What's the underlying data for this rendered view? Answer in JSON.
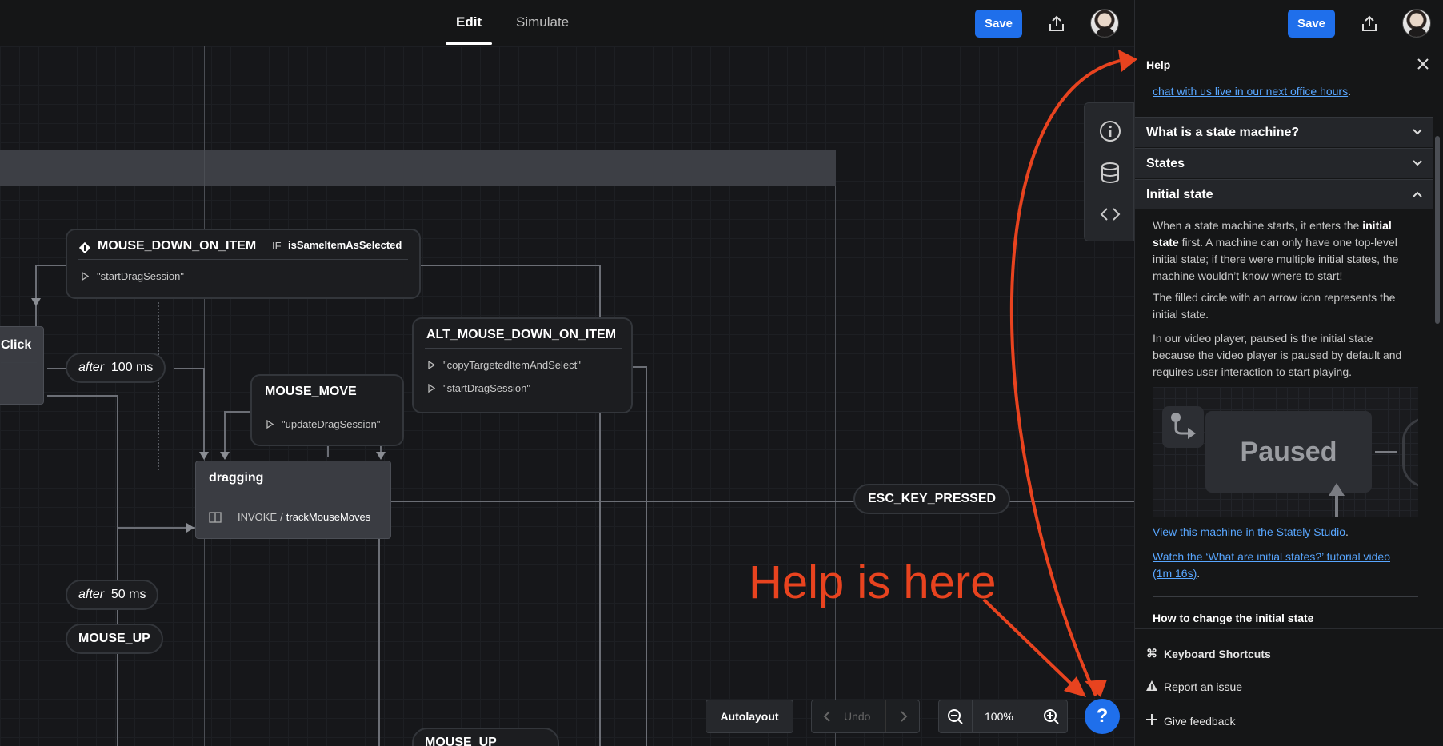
{
  "topbar": {
    "tabs": [
      {
        "label": "Edit",
        "active": true
      },
      {
        "label": "Simulate",
        "active": false
      }
    ],
    "save_label": "Save"
  },
  "panel": {
    "save_label": "Save",
    "help_title": "Help",
    "intro_link": "chat with us live in our next office hours",
    "intro_tail": ".",
    "accordions": [
      {
        "label": "What is a state machine?",
        "expanded": false
      },
      {
        "label": "States",
        "expanded": false
      },
      {
        "label": "Initial state",
        "expanded": true
      }
    ],
    "initial_state": {
      "p1_a": "When a state machine starts, it enters the ",
      "p1_b": "initial state",
      "p1_c": " first. A machine can only have one top-level initial state; if there were multiple initial states, the machine wouldn’t know where to start!",
      "p2": "The filled circle with an arrow icon represents the initial state.",
      "p3": "In our video player, paused is the initial state because the video player is paused by default and requires user interaction to start playing.",
      "illustration_label": "Paused",
      "link1": "View this machine in the Stately Studio",
      "link2": "Watch the ‘What are initial states?’ tutorial video (1m 16s)",
      "subheading": "How to change the initial state"
    },
    "footer": [
      {
        "label": "Keyboard Shortcuts",
        "icon": "command-icon"
      },
      {
        "label": "Report an issue",
        "icon": "warning-icon"
      },
      {
        "label": "Give feedback",
        "icon": "plus-icon"
      }
    ]
  },
  "canvas": {
    "nodes": {
      "mouse_down_on_item": {
        "event": "MOUSE_DOWN_ON_ITEM",
        "if_label": "IF",
        "guard": "isSameItemAsSelected",
        "actions": [
          "\"startDragSession\""
        ]
      },
      "alt_mouse_down": {
        "event": "ALT_MOUSE_DOWN_ON_ITEM",
        "actions": [
          "\"copyTargetedItemAndSelect\"",
          "\"startDragSession\""
        ]
      },
      "mouse_move": {
        "event": "MOUSE_MOVE",
        "actions": [
          "\"updateDragSession\""
        ]
      },
      "dragging": {
        "name": "dragging",
        "invoke_label": "INVOKE",
        "invoke_sep": "/",
        "invoke_src": "trackMouseMoves"
      },
      "click_state": {
        "name": "Click"
      }
    },
    "pills": {
      "after100_after": "after",
      "after100_time": "100 ms",
      "after50_after": "after",
      "after50_time": "50 ms",
      "mouse_up": "MOUSE_UP",
      "mouse_up_2": "MOUSE_UP",
      "esc": "ESC_KEY_PRESSED"
    }
  },
  "bottom_controls": {
    "autolayout": "Autolayout",
    "undo": "Undo",
    "zoom": "100%",
    "help_fab": "?"
  },
  "annotation": {
    "text": "Help is here",
    "color": "#e8431f"
  },
  "colors": {
    "accent": "#1f6feb",
    "link": "#58a6ff",
    "annotation": "#e8431f"
  }
}
